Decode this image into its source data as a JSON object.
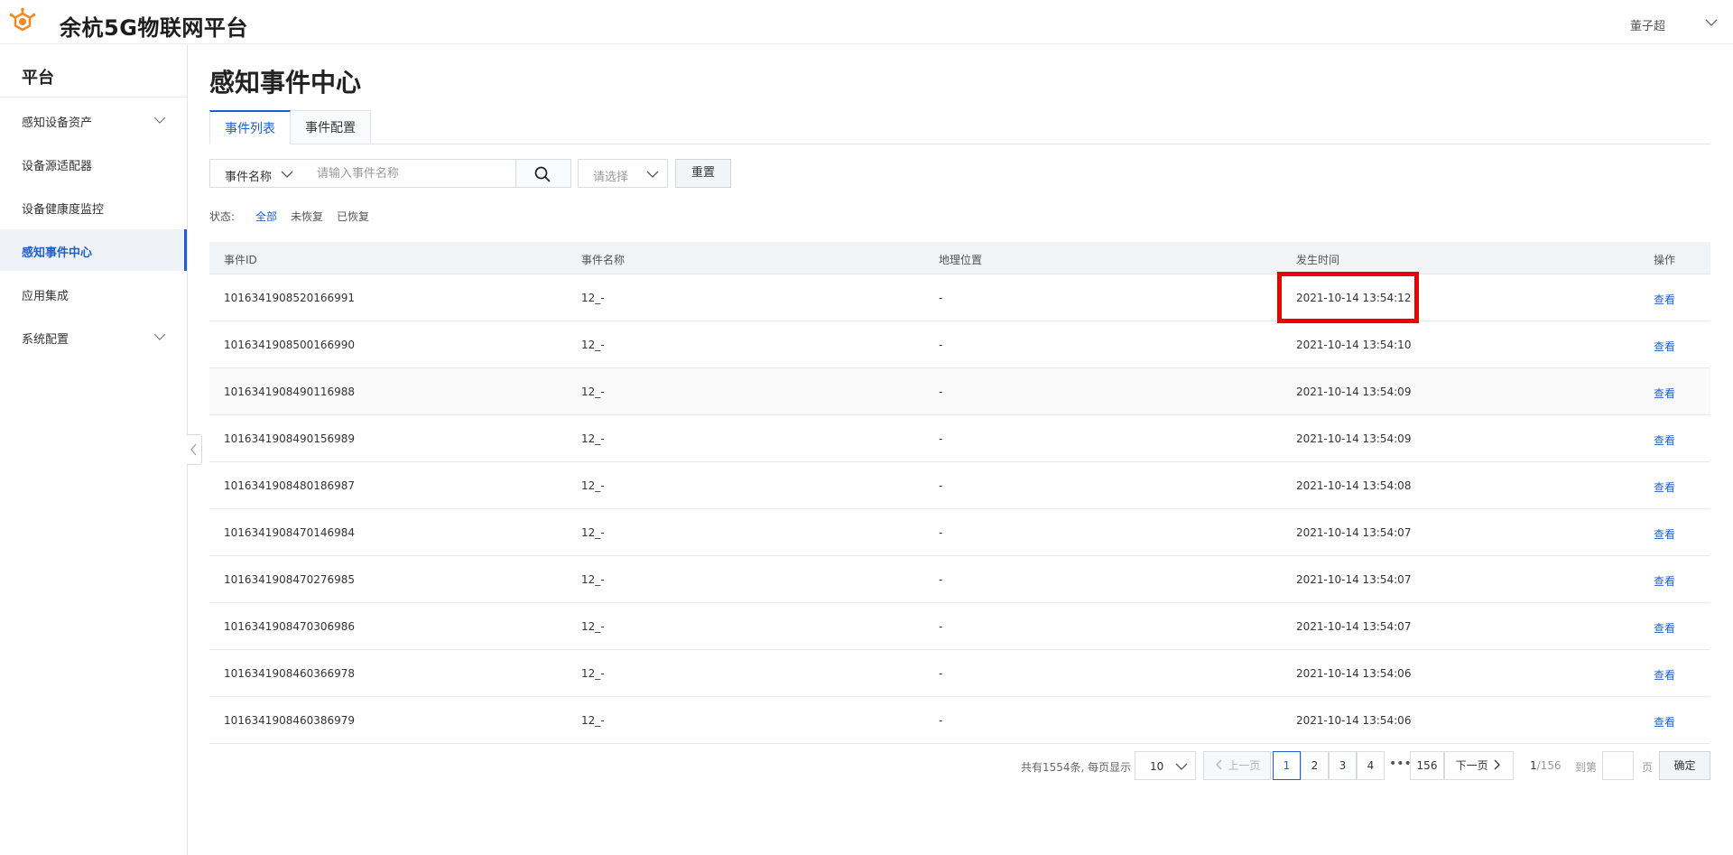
{
  "header": {
    "app_title": "余杭5G物联网平台",
    "user_name": "董子超"
  },
  "sidebar": {
    "title": "平台",
    "items": [
      {
        "label": "感知设备资产",
        "has_chevron": true
      },
      {
        "label": "设备源适配器",
        "has_chevron": false
      },
      {
        "label": "设备健康度监控",
        "has_chevron": false
      },
      {
        "label": "感知事件中心",
        "has_chevron": false,
        "active": true
      },
      {
        "label": "应用集成",
        "has_chevron": false
      },
      {
        "label": "系统配置",
        "has_chevron": true
      }
    ]
  },
  "page": {
    "title": "感知事件中心",
    "tabs": [
      {
        "label": "事件列表",
        "active": true
      },
      {
        "label": "事件配置",
        "active": false
      }
    ]
  },
  "filters": {
    "field_select": "事件名称",
    "search_placeholder": "请输入事件名称",
    "status_select_placeholder": "请选择",
    "reset_label": "重置",
    "status_label": "状态:",
    "status_options": [
      "全部",
      "未恢复",
      "已恢复"
    ],
    "status_selected": "全部"
  },
  "table": {
    "columns": [
      "事件ID",
      "事件名称",
      "地理位置",
      "发生时间",
      "操作"
    ],
    "action_label": "查看",
    "rows": [
      {
        "id": "1016341908520166991",
        "name": "12_-",
        "location": "-",
        "time": "2021-10-14 13:54:12"
      },
      {
        "id": "1016341908500166990",
        "name": "12_-",
        "location": "-",
        "time": "2021-10-14 13:54:10"
      },
      {
        "id": "1016341908490116988",
        "name": "12_-",
        "location": "-",
        "time": "2021-10-14 13:54:09"
      },
      {
        "id": "1016341908490156989",
        "name": "12_-",
        "location": "-",
        "time": "2021-10-14 13:54:09"
      },
      {
        "id": "1016341908480186987",
        "name": "12_-",
        "location": "-",
        "time": "2021-10-14 13:54:08"
      },
      {
        "id": "1016341908470146984",
        "name": "12_-",
        "location": "-",
        "time": "2021-10-14 13:54:07"
      },
      {
        "id": "1016341908470276985",
        "name": "12_-",
        "location": "-",
        "time": "2021-10-14 13:54:07"
      },
      {
        "id": "1016341908470306986",
        "name": "12_-",
        "location": "-",
        "time": "2021-10-14 13:54:07"
      },
      {
        "id": "1016341908460366978",
        "name": "12_-",
        "location": "-",
        "time": "2021-10-14 13:54:06"
      },
      {
        "id": "1016341908460386979",
        "name": "12_-",
        "location": "-",
        "time": "2021-10-14 13:54:06"
      }
    ]
  },
  "pagination": {
    "total_text": "共有1554条, 每页显示",
    "page_size": "10",
    "prev_label": "上一页",
    "pages": [
      "1",
      "2",
      "3",
      "4"
    ],
    "current_page": "1",
    "ellipsis": "•••",
    "last_page": "156",
    "next_label": "下一页",
    "page_info_current": "1",
    "page_info_total": "/156",
    "goto_label": "到第",
    "page_unit": "页",
    "confirm_label": "确定"
  },
  "colors": {
    "accent": "#1f5fcc",
    "logo": "#f08a24",
    "highlight": "#ee0000"
  }
}
